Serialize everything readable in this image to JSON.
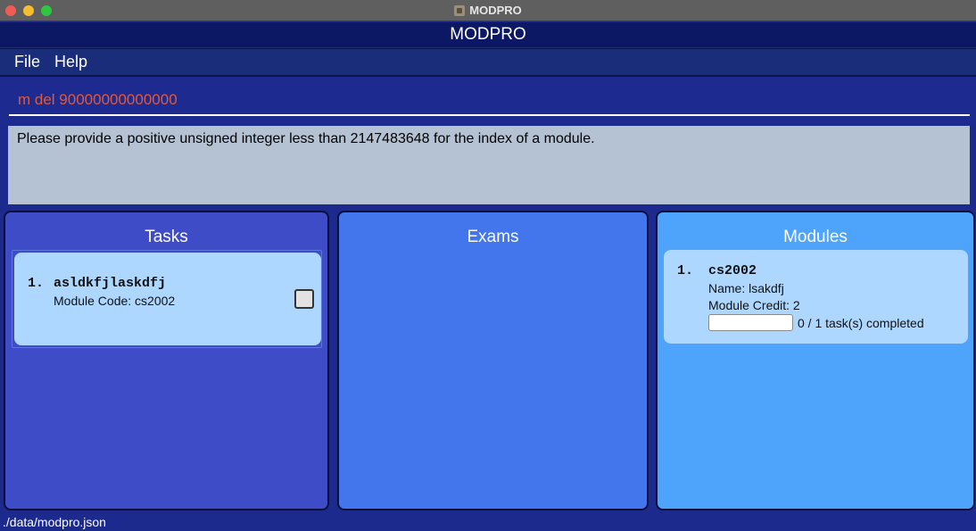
{
  "window": {
    "title": "MODPRO"
  },
  "app": {
    "header": "MODPRO"
  },
  "menu": {
    "items": [
      "File",
      "Help"
    ]
  },
  "command": {
    "value": "m del 90000000000000",
    "placeholder": ""
  },
  "result": {
    "message": "Please provide a positive unsigned integer less than 2147483648 for the index of a module."
  },
  "panels": {
    "tasks": {
      "title": "Tasks",
      "items": [
        {
          "index": "1.",
          "description": "asldkfjlaskdfj",
          "module_code": "Module Code: cs2002",
          "done": false
        }
      ]
    },
    "exams": {
      "title": "Exams",
      "items": []
    },
    "modules": {
      "title": "Modules",
      "items": [
        {
          "index": "1.",
          "code": "cs2002",
          "name": "Name: lsakdfj",
          "credit": "Module Credit: 2",
          "progress": 0,
          "progress_text": "0 / 1 task(s) completed"
        }
      ]
    }
  },
  "status": {
    "path": "./data/modpro.json"
  },
  "colors": {
    "tasks_panel": "#3f4cc7",
    "exams_panel": "#4375ed",
    "modules_panel": "#4ea3fb",
    "card": "#add7ff",
    "command_text": "#e05a3e"
  }
}
